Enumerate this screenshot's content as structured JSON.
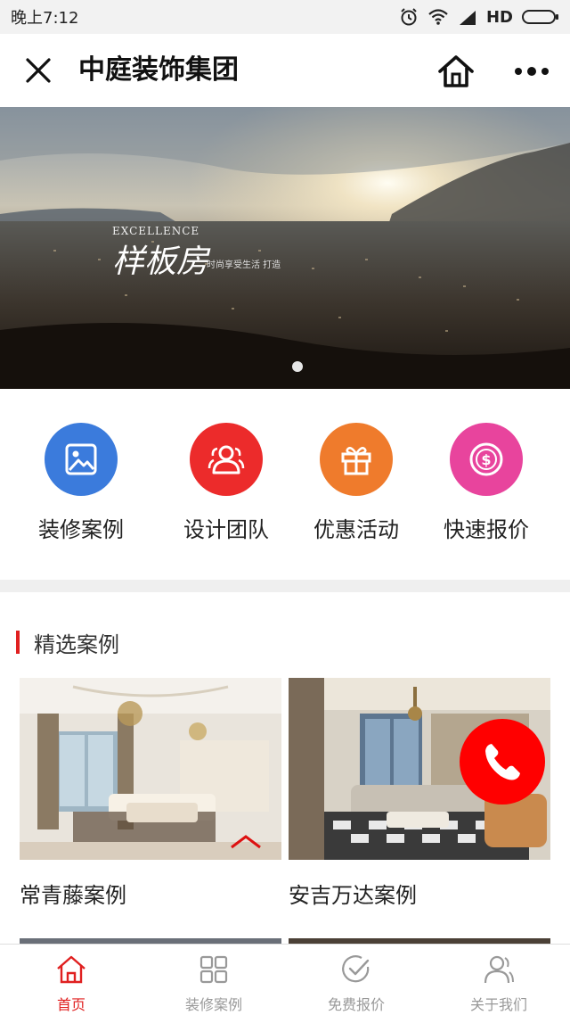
{
  "status_bar": {
    "time": "晚上7:12",
    "network": "HD"
  },
  "nav": {
    "title": "中庭装饰集团"
  },
  "banner": {
    "logo_en": "EXCELLENCE",
    "logo_cn": "样板房",
    "logo_sub": "时尚享受生活 打造"
  },
  "quick_nav": [
    {
      "label": "装修案例",
      "icon": "image-icon",
      "color": "#3b7bdc"
    },
    {
      "label": "设计团队",
      "icon": "team-icon",
      "color": "#ec2b2b"
    },
    {
      "label": "优惠活动",
      "icon": "gift-icon",
      "color": "#ef7b2c"
    },
    {
      "label": "快速报价",
      "icon": "dollar-icon",
      "color": "#e8449d"
    }
  ],
  "section": {
    "title": "精选案例",
    "accent": "#e02020"
  },
  "cases": [
    {
      "label": "常青藤案例"
    },
    {
      "label": "安吉万达案例"
    }
  ],
  "call_button": {
    "color": "#ff0000",
    "icon": "phone-icon"
  },
  "tabs": [
    {
      "label": "首页",
      "icon": "home-icon",
      "active": true
    },
    {
      "label": "装修案例",
      "icon": "grid-icon",
      "active": false
    },
    {
      "label": "免费报价",
      "icon": "check-icon",
      "active": false
    },
    {
      "label": "关于我们",
      "icon": "user-icon",
      "active": false
    }
  ]
}
